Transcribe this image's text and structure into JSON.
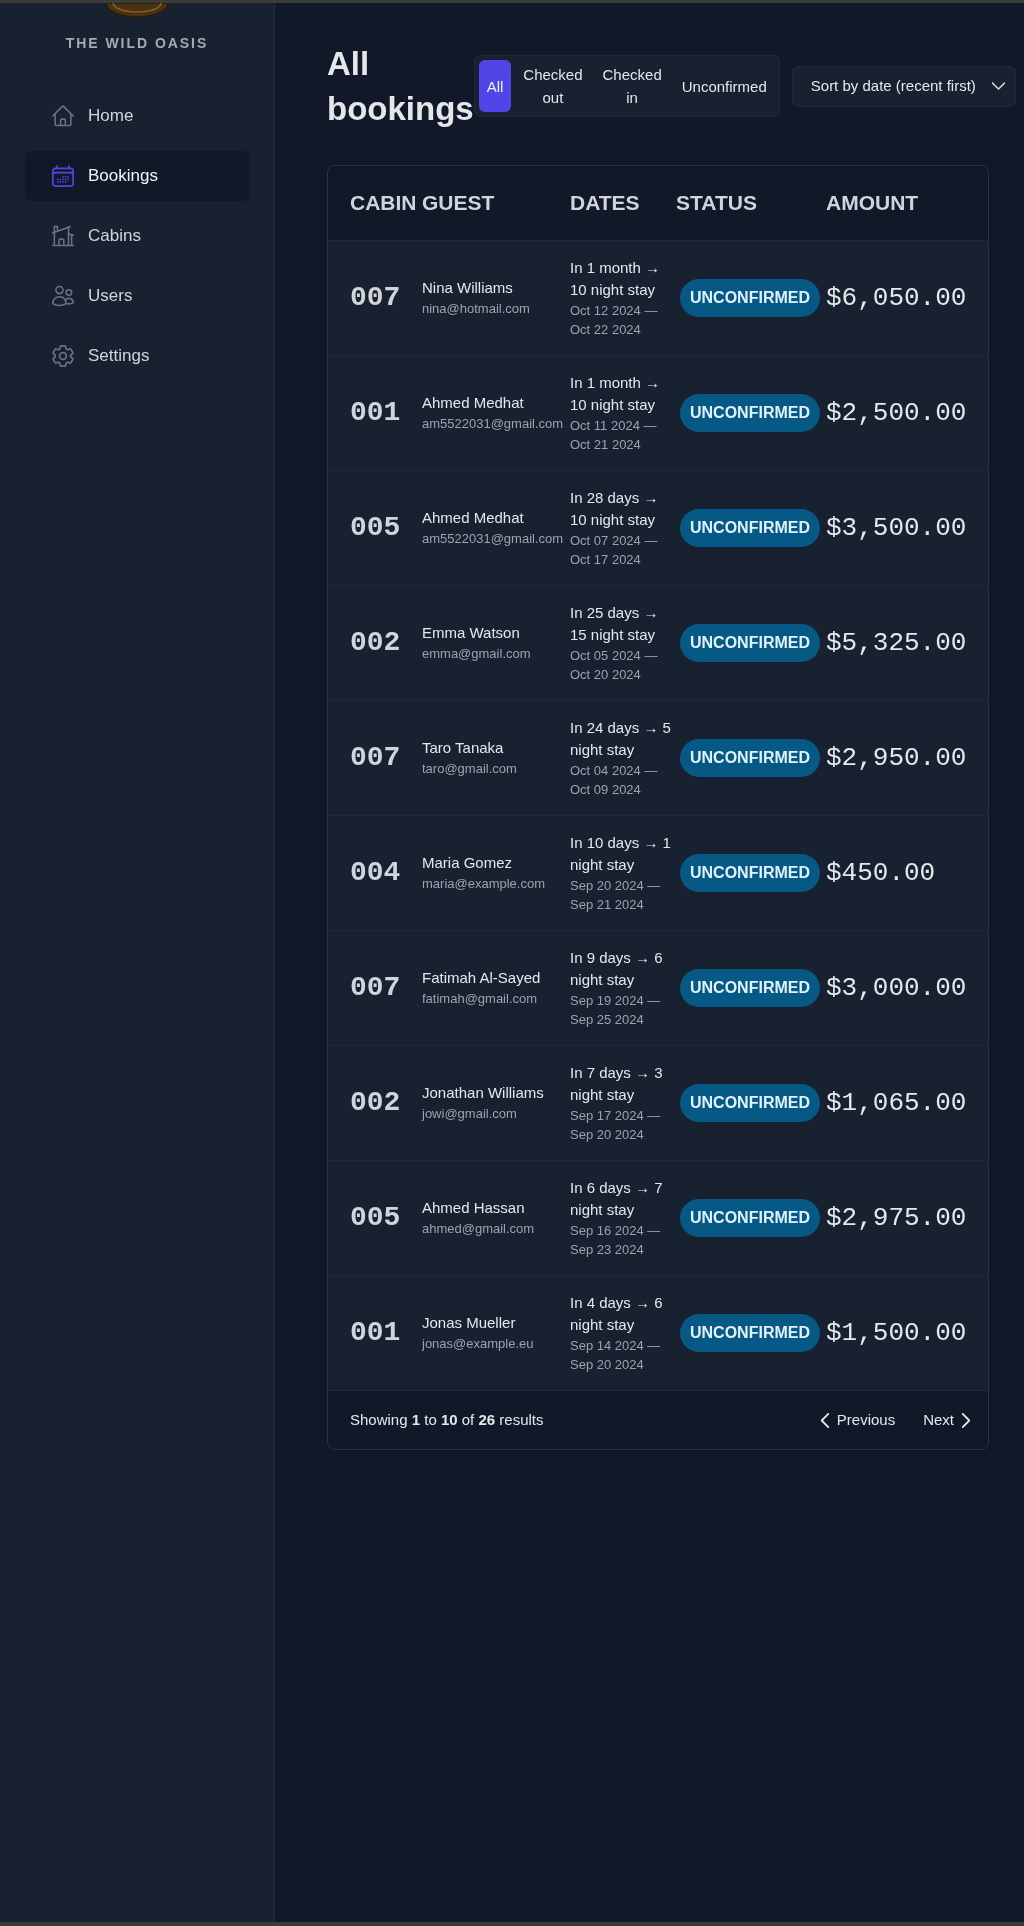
{
  "sidebar": {
    "brand": "THE WILD OASIS",
    "items": [
      {
        "label": "Home",
        "selected": false
      },
      {
        "label": "Bookings",
        "selected": true
      },
      {
        "label": "Cabins",
        "selected": false
      },
      {
        "label": "Users",
        "selected": false
      },
      {
        "label": "Settings",
        "selected": false
      }
    ]
  },
  "header": {
    "title": "All bookings",
    "filters": [
      {
        "label": "All",
        "selected": true
      },
      {
        "label": "Checked out",
        "selected": false
      },
      {
        "label": "Checked in",
        "selected": false
      },
      {
        "label": "Unconfirmed",
        "selected": false
      }
    ],
    "sort": {
      "value": "Sort by date (recent first)"
    }
  },
  "table": {
    "columns": [
      "CABIN",
      "GUEST",
      "DATES",
      "STATUS",
      "AMOUNT"
    ],
    "rows": [
      {
        "cabin": "007",
        "guest_name": "Nina Williams",
        "guest_email": "nina@hotmail.com",
        "stay": "In 1 month → 10 night stay",
        "date_range": "Oct 12 2024 — Oct 22 2024",
        "status": "UNCONFIRMED",
        "amount": "$6,050.00"
      },
      {
        "cabin": "001",
        "guest_name": "Ahmed Medhat",
        "guest_email": "am5522031@gmail.com",
        "stay": "In 1 month → 10 night stay",
        "date_range": "Oct 11 2024 — Oct 21 2024",
        "status": "UNCONFIRMED",
        "amount": "$2,500.00"
      },
      {
        "cabin": "005",
        "guest_name": "Ahmed Medhat",
        "guest_email": "am5522031@gmail.com",
        "stay": "In 28 days → 10 night stay",
        "date_range": "Oct 07 2024 — Oct 17 2024",
        "status": "UNCONFIRMED",
        "amount": "$3,500.00"
      },
      {
        "cabin": "002",
        "guest_name": "Emma Watson",
        "guest_email": "emma@gmail.com",
        "stay": "In 25 days → 15 night stay",
        "date_range": "Oct 05 2024 — Oct 20 2024",
        "status": "UNCONFIRMED",
        "amount": "$5,325.00"
      },
      {
        "cabin": "007",
        "guest_name": "Taro Tanaka",
        "guest_email": "taro@gmail.com",
        "stay": "In 24 days → 5 night stay",
        "date_range": "Oct 04 2024 — Oct 09 2024",
        "status": "UNCONFIRMED",
        "amount": "$2,950.00"
      },
      {
        "cabin": "004",
        "guest_name": "Maria Gomez",
        "guest_email": "maria@example.com",
        "stay": "In 10 days → 1 night stay",
        "date_range": "Sep 20 2024 — Sep 21 2024",
        "status": "UNCONFIRMED",
        "amount": "$450.00"
      },
      {
        "cabin": "007",
        "guest_name": "Fatimah Al-Sayed",
        "guest_email": "fatimah@gmail.com",
        "stay": "In 9 days → 6 night stay",
        "date_range": "Sep 19 2024 — Sep 25 2024",
        "status": "UNCONFIRMED",
        "amount": "$3,000.00"
      },
      {
        "cabin": "002",
        "guest_name": "Jonathan Williams",
        "guest_email": "jowi@gmail.com",
        "stay": "In 7 days → 3 night stay",
        "date_range": "Sep 17 2024 — Sep 20 2024",
        "status": "UNCONFIRMED",
        "amount": "$1,065.00"
      },
      {
        "cabin": "005",
        "guest_name": "Ahmed Hassan",
        "guest_email": "ahmed@gmail.com",
        "stay": "In 6 days → 7 night stay",
        "date_range": "Sep 16 2024 — Sep 23 2024",
        "status": "UNCONFIRMED",
        "amount": "$2,975.00"
      },
      {
        "cabin": "001",
        "guest_name": "Jonas Mueller",
        "guest_email": "jonas@example.eu",
        "stay": "In 4 days → 6 night stay",
        "date_range": "Sep 14 2024 — Sep 20 2024",
        "status": "UNCONFIRMED",
        "amount": "$1,500.00"
      }
    ]
  },
  "pagination": {
    "summary": "Showing **1** to **10** of **26** results",
    "buttons": [
      {
        "label": "Previous",
        "kind": "previous"
      },
      {
        "label": "Next",
        "kind": "next"
      }
    ]
  }
}
